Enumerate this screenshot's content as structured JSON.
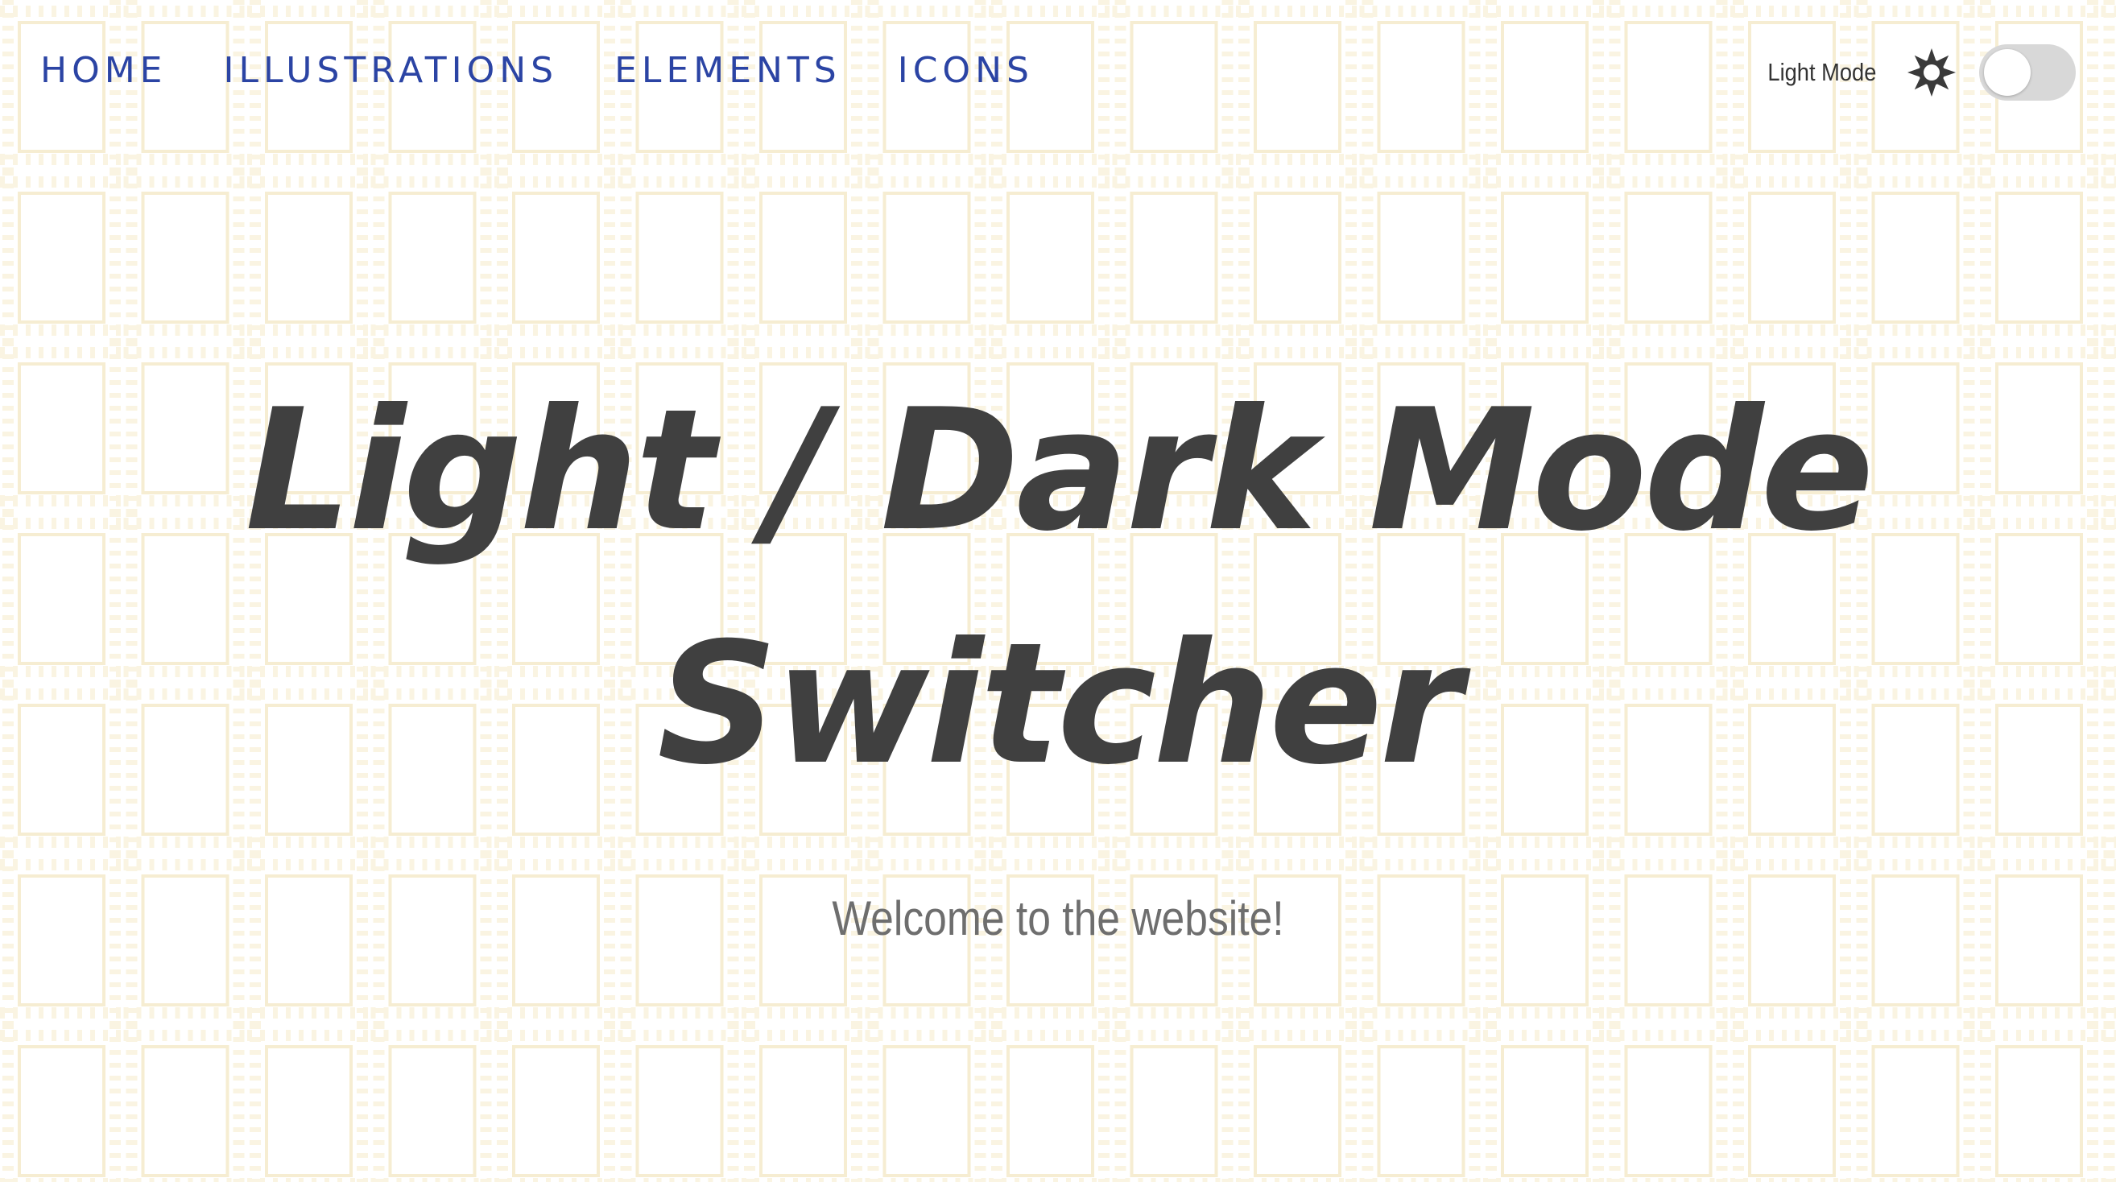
{
  "nav": {
    "items": [
      {
        "label": "HOME"
      },
      {
        "label": "ILLUSTRATIONS"
      },
      {
        "label": "ELEMENTS"
      },
      {
        "label": "ICONS"
      }
    ]
  },
  "mode_switch": {
    "label": "Light Mode",
    "icon": "sun-icon",
    "state": "off"
  },
  "hero": {
    "title": "Light / Dark Mode Switcher",
    "subtitle": "Welcome to the website!"
  },
  "colors": {
    "nav_link": "#2b44a4",
    "title": "#404040",
    "subtitle": "#6e6e6e",
    "pattern": "#f6edd2",
    "toggle_track": "#d8d8d8"
  }
}
